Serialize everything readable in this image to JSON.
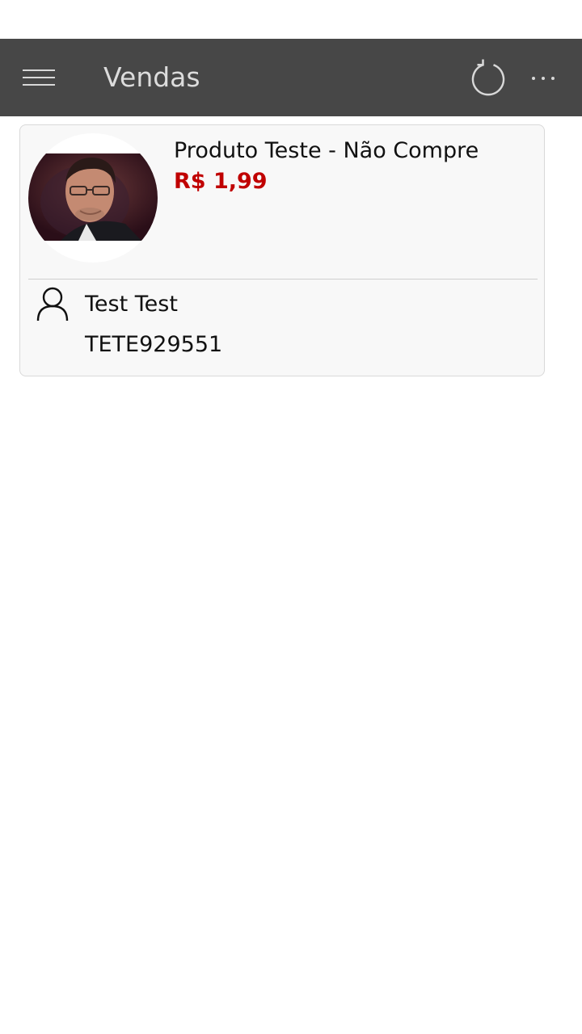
{
  "app_bar": {
    "title": "Vendas",
    "background": "#474747",
    "icons": [
      "menu-icon",
      "refresh-icon",
      "more-icon"
    ]
  },
  "sales": [
    {
      "product_name": "Produto Teste - Não Compre",
      "price": "R$ 1,99",
      "price_color": "#c00000",
      "customer_name": "Test Test",
      "customer_code": "TETE929551",
      "product_image": "man-portrait-photo",
      "customer_icon": "user-icon"
    }
  ]
}
